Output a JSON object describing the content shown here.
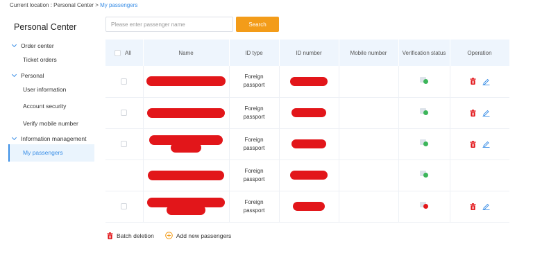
{
  "breadcrumb": {
    "prefix": "Current location :",
    "root": "Personal Center",
    "sep": ">",
    "current": "My passengers"
  },
  "sidebar": {
    "title": "Personal Center",
    "groups": [
      {
        "label": "Order center",
        "items": [
          "Ticket orders"
        ]
      },
      {
        "label": "Personal",
        "items": [
          "User information",
          "Account security",
          "Verify mobile number"
        ]
      },
      {
        "label": "Information management",
        "items": [
          "My passengers"
        ]
      }
    ],
    "active_item": "My passengers"
  },
  "search": {
    "placeholder": "Please enter passenger name",
    "button": "Search"
  },
  "table": {
    "columns": {
      "all": "All",
      "name": "Name",
      "id_type": "ID type",
      "id_number": "ID number",
      "mobile": "Mobile number",
      "verification": "Verification status",
      "operation": "Operation"
    },
    "rows": [
      {
        "id_type": "Foreign passport",
        "mobile": "",
        "verification": "verified",
        "has_checkbox": true,
        "has_actions": true
      },
      {
        "id_type": "Foreign passport",
        "mobile": "",
        "verification": "verified",
        "has_checkbox": true,
        "has_actions": true
      },
      {
        "id_type": "Foreign passport",
        "mobile": "",
        "verification": "verified",
        "has_checkbox": true,
        "has_actions": true
      },
      {
        "id_type": "Foreign passport",
        "mobile": "",
        "verification": "verified",
        "has_checkbox": false,
        "has_actions": false
      },
      {
        "id_type": "Foreign passport",
        "mobile": "",
        "verification": "failed",
        "has_checkbox": true,
        "has_actions": true
      }
    ]
  },
  "footer": {
    "batch_delete": "Batch deletion",
    "add_new": "Add new passengers"
  },
  "colors": {
    "accent": "#3a8ee6",
    "search_button": "#f39c19",
    "delete_red": "#e2161a",
    "verified_green": "#3cb55a",
    "header_bg": "#eef5fd"
  },
  "icons": [
    "chevron-down-icon",
    "checkbox",
    "id-card-icon",
    "trash-icon",
    "edit-icon",
    "plus-circle-icon"
  ]
}
